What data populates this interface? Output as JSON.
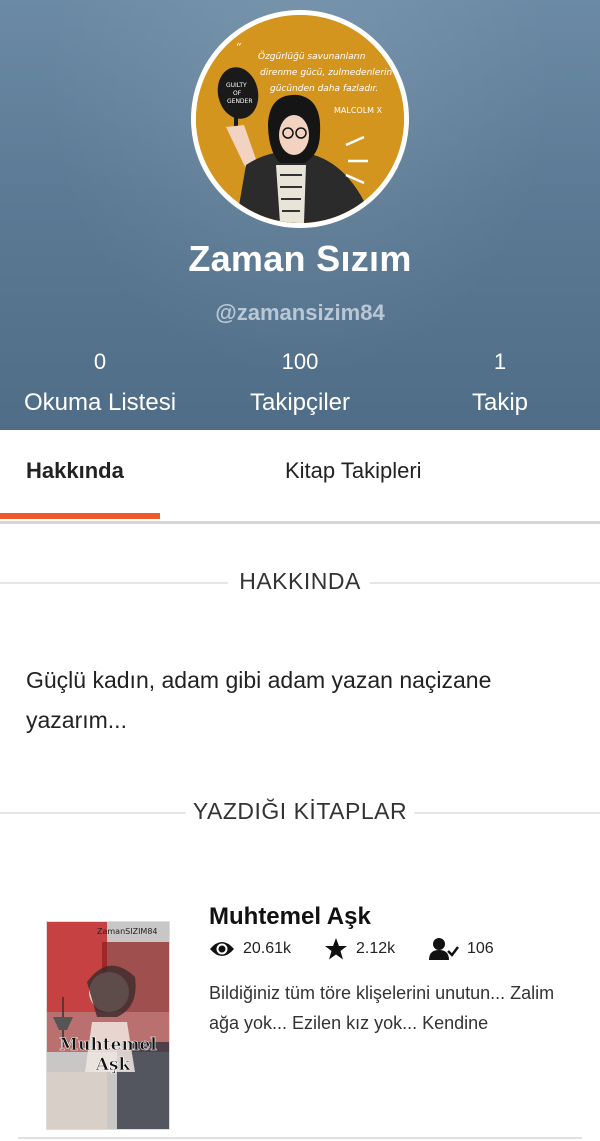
{
  "profile": {
    "display_name": "Zaman Sızım",
    "username": "@zamansizim84",
    "avatar_quote": "Özgürlüğü savunanların direnme gücü, zulmedenlerin gücünden daha fazladır.",
    "avatar_author": "MALCOLM X",
    "avatar_sign": "GUILTY OF GENDER"
  },
  "stats": [
    {
      "value": "0",
      "label": "Okuma Listesi"
    },
    {
      "value": "100",
      "label": "Takipçiler"
    },
    {
      "value": "1",
      "label": "Takip"
    }
  ],
  "tabs": {
    "about": "Hakkında",
    "book_follows": "Kitap Takipleri"
  },
  "about_section": {
    "heading": "HAKKINDA",
    "text": "Güçlü kadın, adam gibi adam yazan naçizane yazarım..."
  },
  "books_section": {
    "heading": "YAZDIĞI KİTAPLAR",
    "books": [
      {
        "title": "Muhtemel Aşk",
        "cover_author": "ZamanSIZIM84",
        "cover_title_line1": "Muhtemel",
        "cover_title_line2": "Aşk",
        "reads": "20.61k",
        "votes": "2.12k",
        "followers": "106",
        "description": "Bildiğiniz tüm töre klişelerini unutun... Zalim ağa yok... Ezilen kız yok... Kendine"
      }
    ]
  },
  "colors": {
    "accent": "#f05a28",
    "header_bg": "#5c7a95",
    "avatar_bg": "#d4951f"
  },
  "icons": {
    "reads": "eye-icon",
    "votes": "star-icon",
    "followers": "user-check-icon"
  }
}
